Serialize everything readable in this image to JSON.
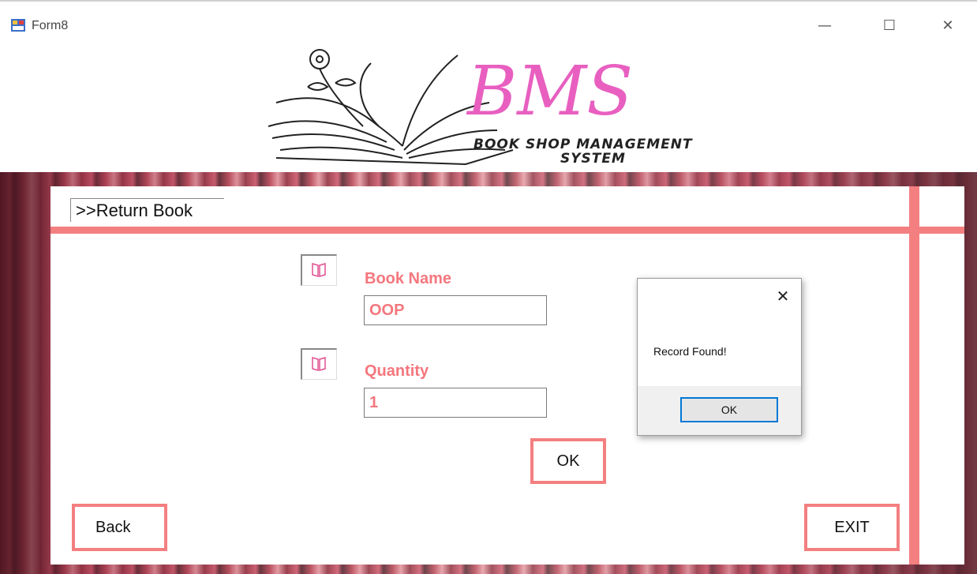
{
  "window": {
    "title": "Form8",
    "minimize_glyph": "—",
    "maximize_glyph": "☐",
    "close_glyph": "✕"
  },
  "logo": {
    "big_text": "BMS",
    "line1": "BOOK SHOP MANAGEMENT",
    "line2": "SYSTEM",
    "accent": "#e85fc0"
  },
  "section": {
    "label": ">>Return Book"
  },
  "form": {
    "book_name_label": "Book Name",
    "book_name_value": "OOP",
    "quantity_label": "Quantity",
    "quantity_value": "1",
    "ok_label": "OK"
  },
  "nav": {
    "back_label": "Back",
    "exit_label": "EXIT"
  },
  "message_box": {
    "text": "Record Found!",
    "ok_label": "OK",
    "close_glyph": "✕"
  },
  "colors": {
    "accent_pink": "#f47f80",
    "label_pink": "#f4777e",
    "dialog_blue": "#0078d7"
  }
}
